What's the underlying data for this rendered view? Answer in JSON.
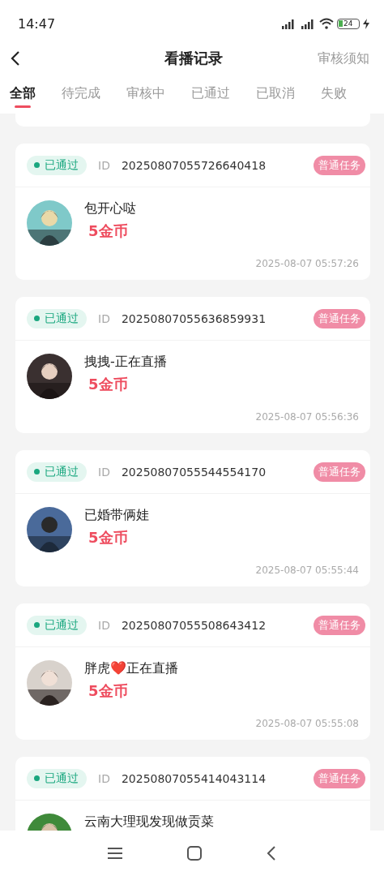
{
  "status_bar": {
    "time": "14:47",
    "battery": "24"
  },
  "header": {
    "title": "看播记录",
    "action": "审核须知"
  },
  "tabs": [
    {
      "label": "全部",
      "selected": true
    },
    {
      "label": "待完成",
      "selected": false
    },
    {
      "label": "审核中",
      "selected": false
    },
    {
      "label": "已通过",
      "selected": false
    },
    {
      "label": "已取消",
      "selected": false
    },
    {
      "label": "失败",
      "selected": false
    }
  ],
  "records": [
    {
      "status": "已通过",
      "id_label": "ID",
      "id": "20250807055726640418",
      "tag": "普通任务",
      "name": "包开心哒",
      "reward": "5金币",
      "time": "2025-08-07 05:57:26"
    },
    {
      "status": "已通过",
      "id_label": "ID",
      "id": "20250807055636859931",
      "tag": "普通任务",
      "name": "拽拽-正在直播",
      "reward": "5金币",
      "time": "2025-08-07 05:56:36"
    },
    {
      "status": "已通过",
      "id_label": "ID",
      "id": "20250807055544554170",
      "tag": "普通任务",
      "name": "已婚带俩娃",
      "reward": "5金币",
      "time": "2025-08-07 05:55:44"
    },
    {
      "status": "已通过",
      "id_label": "ID",
      "id": "20250807055508643412",
      "tag": "普通任务",
      "name": "胖虎❤️正在直播",
      "reward": "5金币",
      "time": "2025-08-07 05:55:08"
    },
    {
      "status": "已通过",
      "id_label": "ID",
      "id": "20250807055414043114",
      "tag": "普通任务",
      "name": "云南大理现发现做贡菜"
    }
  ]
}
